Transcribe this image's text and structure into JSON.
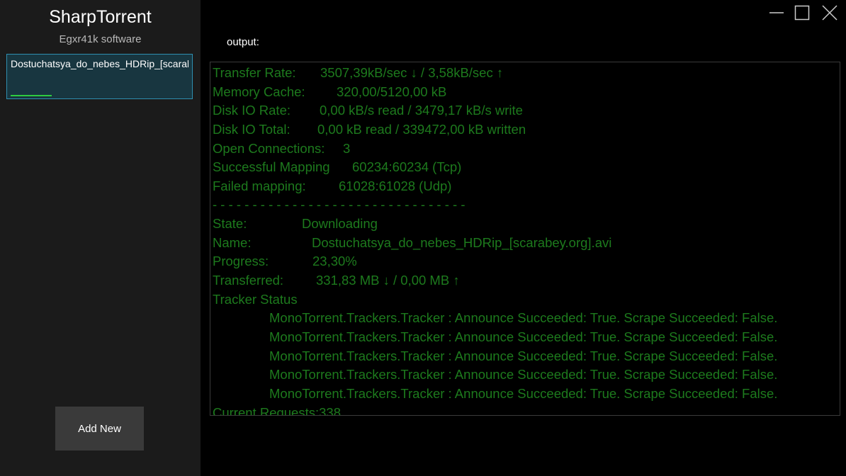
{
  "sidebar": {
    "app_title": "SharpTorrent",
    "app_subtitle": "Egxr41k software",
    "torrents": [
      {
        "name": "Dostuchatsya_do_nebes_HDRip_[scarabey.org].avi",
        "progress_fraction": 0.233
      }
    ],
    "add_new_label": "Add New"
  },
  "window_controls": {
    "minimize_icon": "minimize-icon",
    "maximize_icon": "maximize-icon",
    "close_icon": "close-icon"
  },
  "main": {
    "output_label": "output:",
    "output_lines": [
      {
        "key": "Transfer Rate:",
        "value": "3507,39kB/sec ↓ / 3,58kB/sec ↑"
      },
      {
        "key": "Memory Cache:",
        "value": "320,00/5120,00 kB"
      },
      {
        "key": "Disk IO Rate:",
        "value": "0,00 kB/s read / 3479,17 kB/s write"
      },
      {
        "key": "Disk IO Total:",
        "value": "0,00 kB read / 339472,00 kB written"
      },
      {
        "key": "Open Connections:",
        "value": "3"
      },
      {
        "key": "Successful Mapping",
        "value": "60234:60234 (Tcp)"
      },
      {
        "key": "Failed mapping:",
        "value": "61028:61028 (Udp)"
      },
      {
        "key": "- - - - - - - - - - - - - - - - - - - - - - - - - - - - - - - -",
        "value": ""
      },
      {
        "key": "State:",
        "value": "Downloading"
      },
      {
        "key": "Name:",
        "value": "Dostuchatsya_do_nebes_HDRip_[scarabey.org].avi"
      },
      {
        "key": "Progress:",
        "value": "23,30%"
      },
      {
        "key": "Transferred:",
        "value": "331,83 MB ↓ / 0,00 MB ↑"
      },
      {
        "key": "Tracker Status",
        "value": ""
      },
      {
        "key": "",
        "value": "MonoTorrent.Trackers.Tracker : Announce Succeeded: True. Scrape Succeeded: False.",
        "indent": true
      },
      {
        "key": "",
        "value": "MonoTorrent.Trackers.Tracker : Announce Succeeded: True. Scrape Succeeded: False.",
        "indent": true
      },
      {
        "key": "",
        "value": "MonoTorrent.Trackers.Tracker : Announce Succeeded: True. Scrape Succeeded: False.",
        "indent": true
      },
      {
        "key": "",
        "value": "MonoTorrent.Trackers.Tracker : Announce Succeeded: True. Scrape Succeeded: False.",
        "indent": true
      },
      {
        "key": "",
        "value": "MonoTorrent.Trackers.Tracker : Announce Succeeded: True. Scrape Succeeded: False.",
        "indent": true
      },
      {
        "key": "Current Requests:",
        "value": "338"
      }
    ]
  },
  "colors": {
    "sidebar_bg": "#1b1b1b",
    "selected_item_bg": "#183640",
    "selected_item_border": "#2f8fb0",
    "progress_green": "#2ecc40",
    "output_text": "#1d7a1d"
  }
}
